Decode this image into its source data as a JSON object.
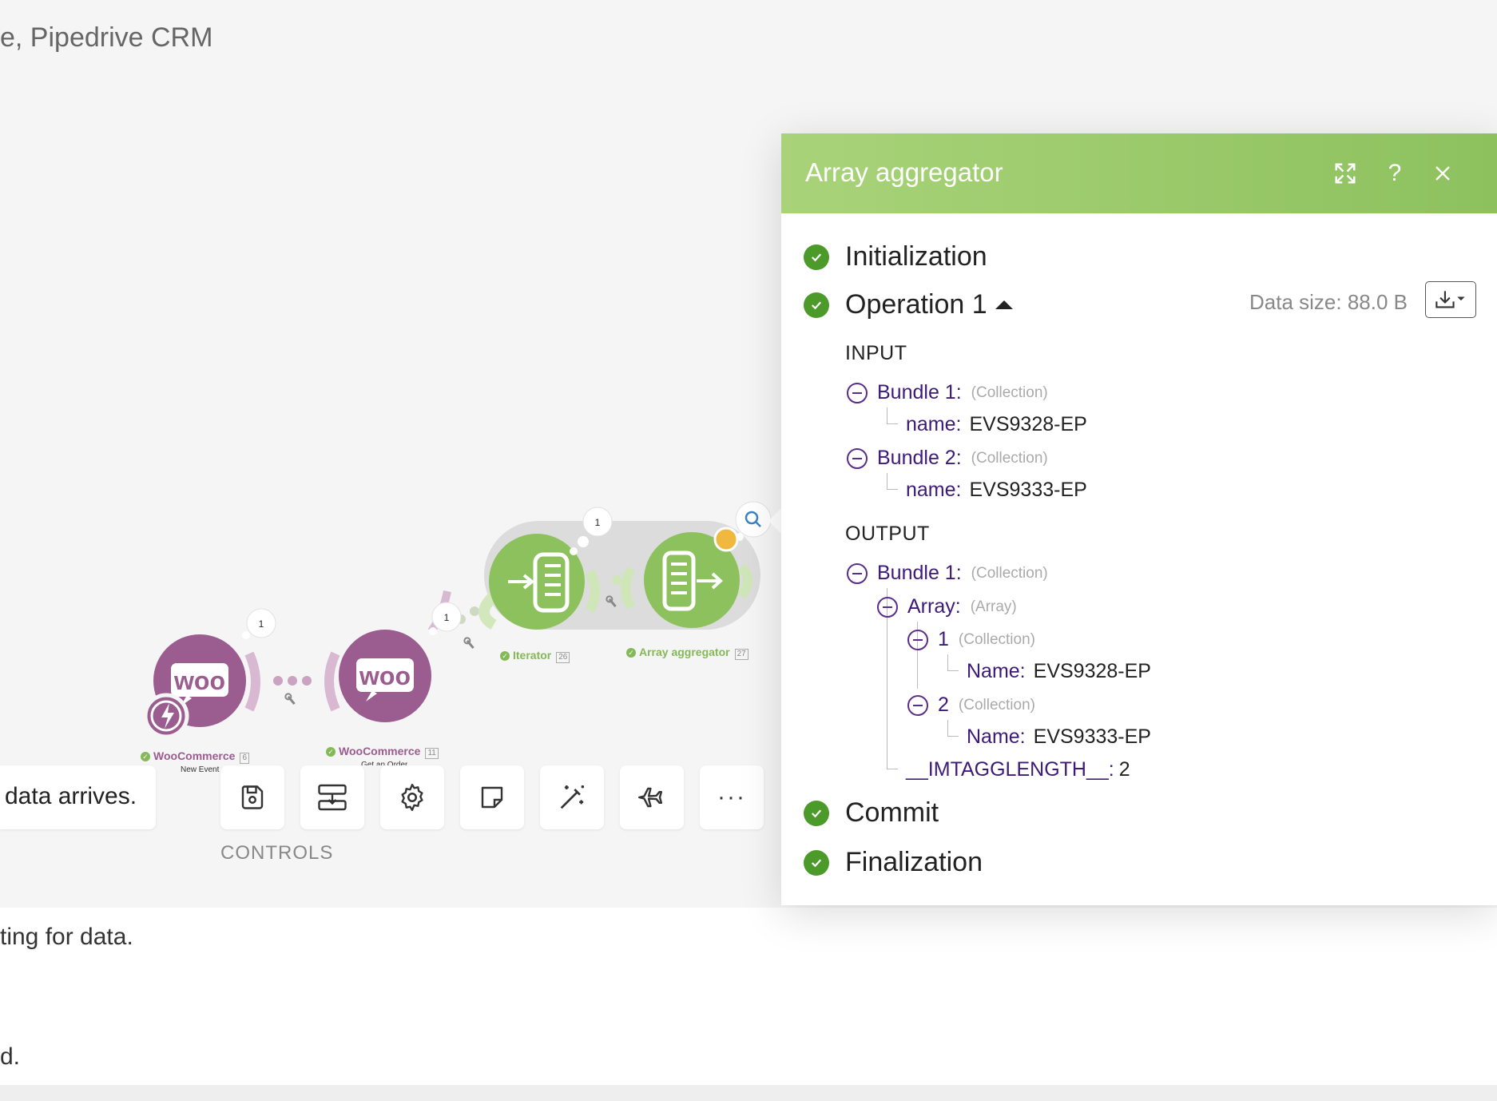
{
  "scenario": {
    "title": "e, Pipedrive CRM"
  },
  "info_box": {
    "text": "data arrives."
  },
  "log": {
    "line1": "ting for data.",
    "line2": "d."
  },
  "controls": {
    "label": "CONTROLS",
    "buttons": [
      "save-icon",
      "import-icon",
      "gear-icon",
      "note-icon",
      "magic-wand-icon",
      "airplane-icon",
      "more-icon"
    ],
    "more_label": "···"
  },
  "nodes": [
    {
      "name": "WooCommerce",
      "number": "6",
      "subtitle": "New Event",
      "badge": "1",
      "logo": "woo"
    },
    {
      "name": "WooCommerce",
      "number": "11",
      "subtitle": "Get an Order",
      "badge": "1",
      "logo": "woo"
    },
    {
      "name": "Iterator",
      "number": "26",
      "badge": "1"
    },
    {
      "name": "Array aggregator",
      "number": "27",
      "badge": "1"
    }
  ],
  "panel": {
    "title": "Array aggregator",
    "header_buttons": [
      "expand-icon",
      "help-icon",
      "close-icon"
    ],
    "help_label": "?",
    "data_size": "Data size: 88.0 B",
    "steps": {
      "initialization": "Initialization",
      "operation": "Operation 1",
      "commit": "Commit",
      "finalization": "Finalization"
    },
    "input": {
      "title": "INPUT",
      "bundles": [
        {
          "key": "Bundle 1:",
          "type": "(Collection)",
          "field_key": "name:",
          "field_value": "EVS9328-EP"
        },
        {
          "key": "Bundle 2:",
          "type": "(Collection)",
          "field_key": "name:",
          "field_value": "EVS9333-EP"
        }
      ]
    },
    "output": {
      "title": "OUTPUT",
      "bundle": {
        "key": "Bundle 1:",
        "type": "(Collection)"
      },
      "array": {
        "key": "Array:",
        "type": "(Array)"
      },
      "items": [
        {
          "key": "1",
          "type": "(Collection)",
          "field_key": "Name:",
          "field_value": "EVS9328-EP"
        },
        {
          "key": "2",
          "type": "(Collection)",
          "field_key": "Name:",
          "field_value": "EVS9333-EP"
        }
      ],
      "length_key": "__IMTAGGLENGTH__:",
      "length_value": "2"
    }
  },
  "colors": {
    "accent_green": "#8dc15e",
    "status_green": "#4c9a2a",
    "woo_purple": "#9b5c8f",
    "tree_key": "#3d1a78"
  }
}
